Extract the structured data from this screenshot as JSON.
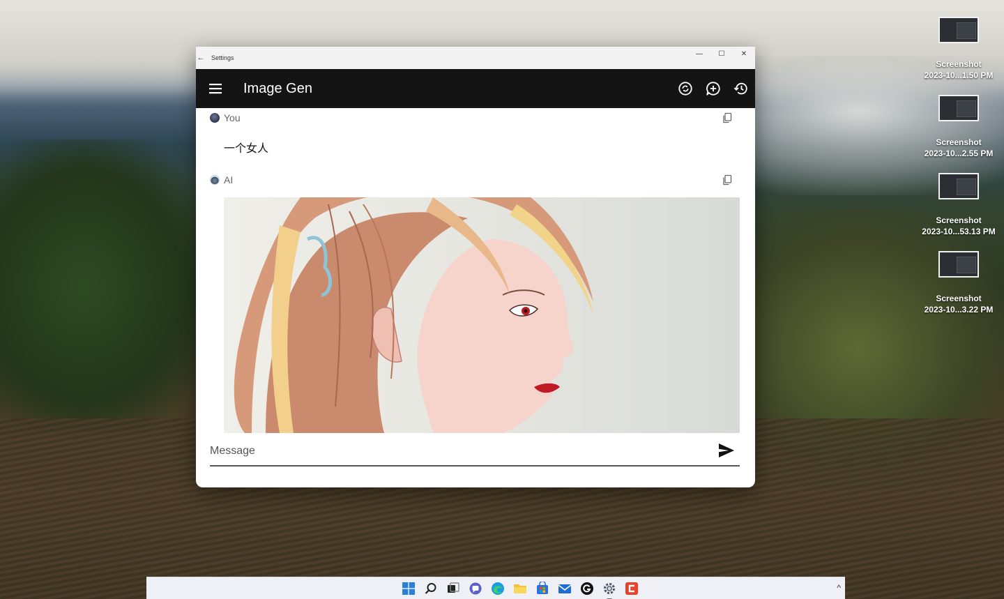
{
  "desktop": {
    "icons": [
      {
        "name": "Screenshot",
        "sub": "2023-10...1.50 PM"
      },
      {
        "name": "Screenshot",
        "sub": "2023-10...2.55 PM"
      },
      {
        "name": "Screenshot",
        "sub": "2023-10...53.13 PM"
      },
      {
        "name": "Screenshot",
        "sub": "2023-10...3.22 PM"
      }
    ]
  },
  "window": {
    "title": "Settings",
    "back_glyph": "←",
    "controls": {
      "minimize": "—",
      "maximize": "☐",
      "close": "✕"
    }
  },
  "appbar": {
    "title": "Image Gen",
    "actions": [
      "model-switch",
      "new-chat",
      "history"
    ]
  },
  "chat": {
    "messages": [
      {
        "sender": "You",
        "text": "一个女人"
      },
      {
        "sender": "AI",
        "image": "generated portrait of a woman"
      }
    ]
  },
  "composer": {
    "placeholder": "Message"
  },
  "taskbar": {
    "icons": [
      "windows-start",
      "search",
      "task-view",
      "chat",
      "edge",
      "file-explorer",
      "store",
      "mail",
      "github",
      "settings",
      "app-c"
    ],
    "active": "settings",
    "tray_chevron": "^"
  },
  "colors": {
    "appbar_bg": "#141414",
    "appbar_fg": "#ffffff",
    "window_bg": "#ffffff",
    "taskbar_bg": "#eef0f5"
  }
}
